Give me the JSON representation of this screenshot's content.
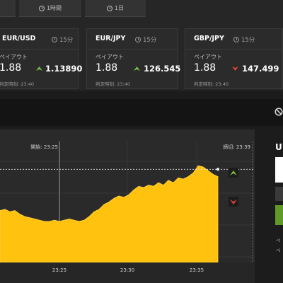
{
  "tabs": [
    {
      "label": ""
    },
    {
      "label": "1時間"
    },
    {
      "label": "1日"
    }
  ],
  "cards": [
    {
      "pair": "EUR/USD",
      "timeframe": "15分",
      "payout_label": "ペイアウト",
      "payout": "1.88",
      "rate": "1.13890",
      "direction": "up",
      "judge_time": "判定時刻: 23:40"
    },
    {
      "pair": "EUR/JPY",
      "timeframe": "15分",
      "payout_label": "ペイアウト",
      "payout": "1.88",
      "rate": "126.545",
      "direction": "up",
      "judge_time": "判定時刻: 23:40"
    },
    {
      "pair": "GBP/JPY",
      "timeframe": "15分",
      "payout_label": "ペイアウト",
      "payout": "1.88",
      "rate": "147.499",
      "direction": "down",
      "judge_time": "判定時刻: 23:40"
    }
  ],
  "colors": {
    "up": "#7cc242",
    "down": "#e0453a",
    "area": "#ffc20e",
    "buy": "#5f9a28"
  },
  "chart": {
    "start_label": "開始: 23:25",
    "end_label": "締切: 23:39",
    "x_ticks": [
      "23:25",
      "23:30",
      "23:35"
    ]
  },
  "chart_data": {
    "type": "area",
    "series": [
      {
        "values": [
          0.43,
          0.44,
          0.42,
          0.43,
          0.4,
          0.38,
          0.37,
          0.36,
          0.35,
          0.34,
          0.34,
          0.35,
          0.34,
          0.35,
          0.36,
          0.35,
          0.34,
          0.35,
          0.38,
          0.42,
          0.44,
          0.48,
          0.5,
          0.53,
          0.55,
          0.54,
          0.56,
          0.6,
          0.63,
          0.62,
          0.64,
          0.63,
          0.66,
          0.64,
          0.68,
          0.66,
          0.7,
          0.69,
          0.71,
          0.74,
          0.8,
          0.79,
          0.76,
          0.73,
          0.71
        ]
      }
    ]
  },
  "panel": {
    "title": "U",
    "note1": "ペ",
    "note2": "ペ"
  }
}
